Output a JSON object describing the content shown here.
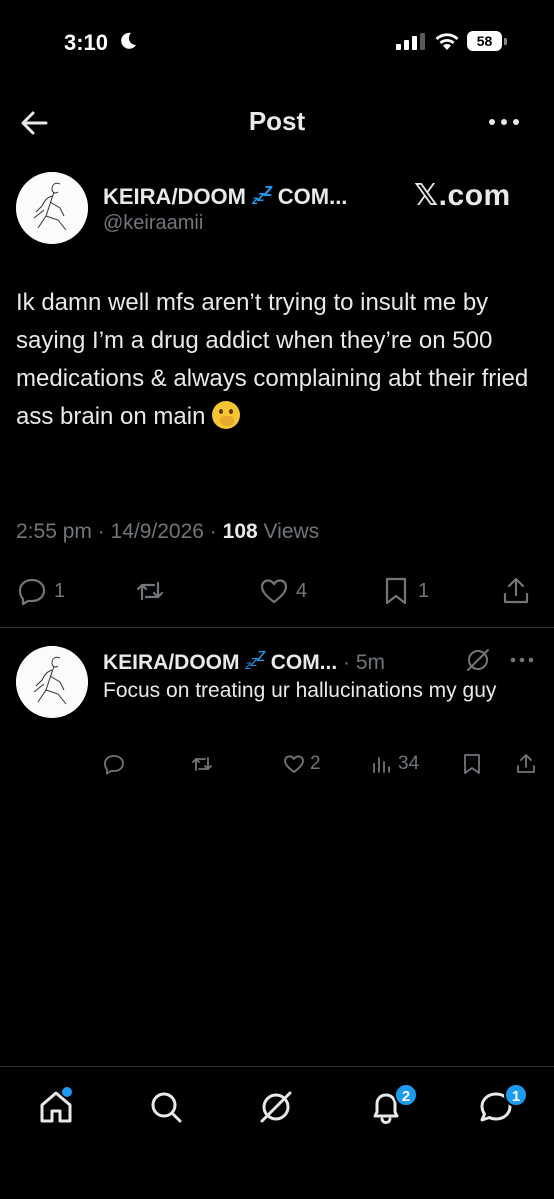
{
  "status_bar": {
    "time": "3:10",
    "battery": "58"
  },
  "header": {
    "title": "Post"
  },
  "post": {
    "author_name": "KEIRA/DOOM",
    "author_name_suffix": "COM...",
    "author_handle": "@keiraamii",
    "watermark": "𝕏.com",
    "text": "Ik damn well mfs aren’t trying to insult me by saying I’m a drug addict when they’re on 500 medications & always complaining abt their fried ass brain on main",
    "time": "2:55 pm · 14/9/2026 · ",
    "views_count": "108",
    "views_label": " Views",
    "actions": {
      "replies": "1",
      "reposts": "",
      "likes": "4",
      "bookmarks": "1"
    }
  },
  "reply": {
    "author_name": "KEIRA/DOOM",
    "author_name_suffix": "COM...",
    "time": " · 5m",
    "text": "Focus on treating ur hallucinations my guy",
    "actions": {
      "replies": "",
      "reposts": "",
      "likes": "2",
      "views": "34"
    }
  },
  "bottom_nav": {
    "notifications_badge": "2",
    "messages_badge": "1"
  },
  "colors": {
    "background": "#000000",
    "text": "#e7e9ea",
    "muted": "#71767b",
    "accent": "#1d9bf0",
    "divider": "#2f3336"
  }
}
